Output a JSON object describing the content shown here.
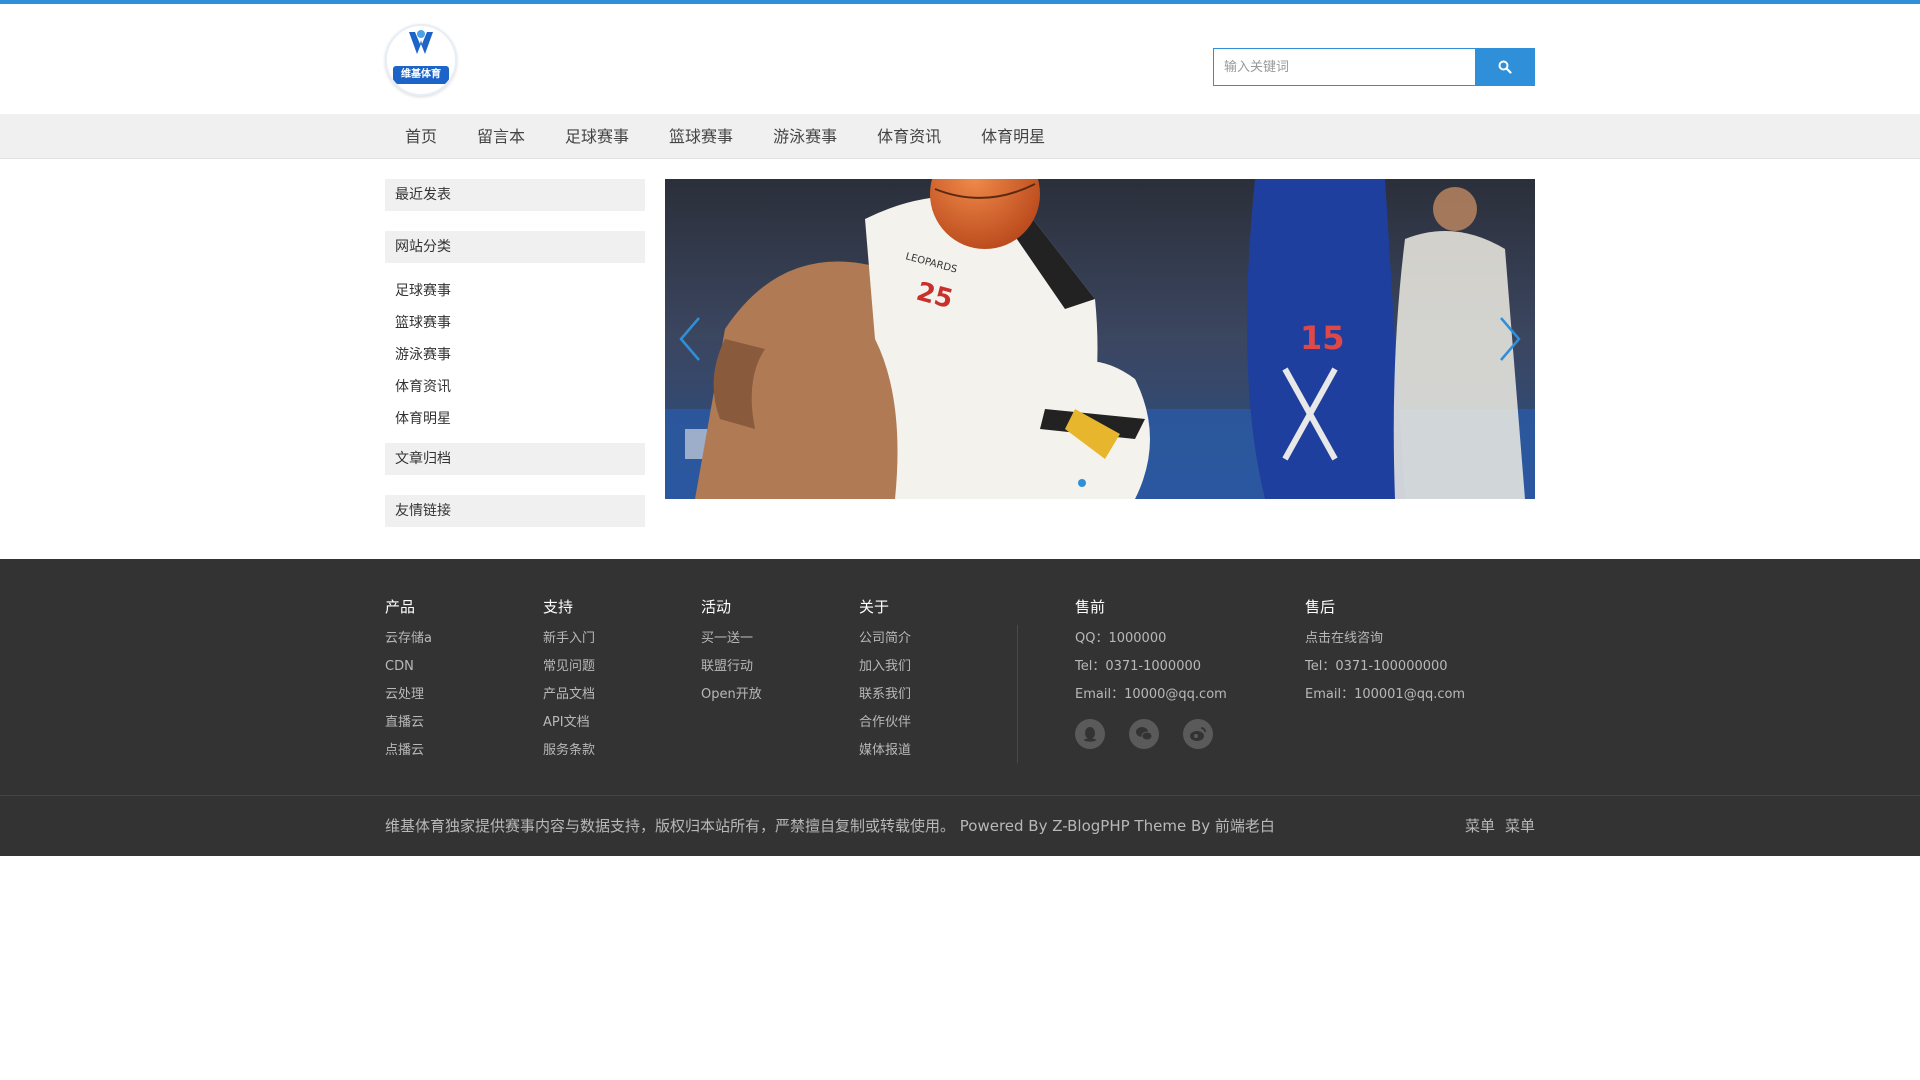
{
  "logo": {
    "text": "维基体育"
  },
  "search": {
    "placeholder": "输入关键词"
  },
  "nav": [
    "首页",
    "留言本",
    "足球赛事",
    "篮球赛事",
    "游泳赛事",
    "体育资讯",
    "体育明星"
  ],
  "sidebar": {
    "recent_title": "最近发表",
    "categories_title": "网站分类",
    "categories": [
      "足球赛事",
      "篮球赛事",
      "游泳赛事",
      "体育资讯",
      "体育明星"
    ],
    "archive_title": "文章归档",
    "links_title": "友情链接"
  },
  "banner": {
    "jersey_text": "LEOPARDS",
    "jersey_number": "25",
    "opponent_number": "15",
    "active_slide": 1
  },
  "footer": {
    "product": {
      "title": "产品",
      "items": [
        "云存储a",
        "CDN",
        "云处理",
        "直播云",
        "点播云"
      ]
    },
    "support": {
      "title": "支持",
      "items": [
        "新手入门",
        "常见问题",
        "产品文档",
        "API文档",
        "服务条款"
      ]
    },
    "activity": {
      "title": "活动",
      "items": [
        "买一送一",
        "联盟行动",
        "Open开放"
      ]
    },
    "about": {
      "title": "关于",
      "items": [
        "公司简介",
        "加入我们",
        "联系我们",
        "合作伙伴",
        "媒体报道"
      ]
    },
    "presale": {
      "title": "售前",
      "items": [
        "QQ：1000000",
        "Tel：0371-1000000",
        "Email：10000@qq.com"
      ]
    },
    "aftersale": {
      "title": "售后",
      "items": [
        "点击在线咨询",
        "Tel：0371-100000000",
        "Email：100001@qq.com"
      ]
    },
    "social_icons": [
      "qq-icon",
      "wechat-icon",
      "weibo-icon"
    ],
    "copyright": "维基体育独家提供赛事内容与数据支持，版权归本站所有，严禁擅自复制或转载使用。 Powered By Z-BlogPHP Theme By 前端老白",
    "menu": [
      "菜单",
      "菜单"
    ]
  },
  "colors": {
    "accent": "#2f8fd8",
    "footer_bg": "#333333",
    "nav_bg": "#f0f0f0"
  }
}
